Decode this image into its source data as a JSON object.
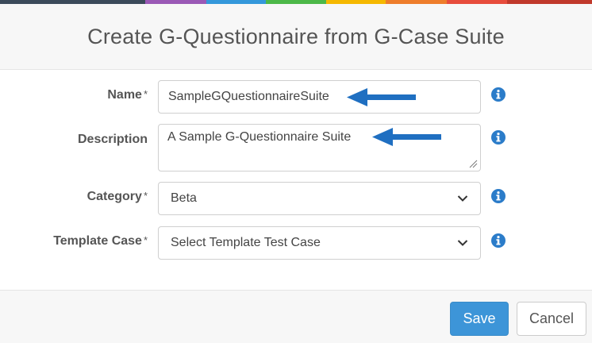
{
  "stripe_colors": [
    "#3b4a5a",
    "#9b59b6",
    "#3498db",
    "#4cb848",
    "#f5b800",
    "#ee7d2b",
    "#e74c3c",
    "#c0392b"
  ],
  "dialog": {
    "title": "Create G-Questionnaire from G-Case Suite"
  },
  "form": {
    "name": {
      "label": "Name",
      "required_mark": "*",
      "value": "SampleGQuestionnaireSuite"
    },
    "description": {
      "label": "Description",
      "value": "A Sample G-Questionnaire Suite"
    },
    "category": {
      "label": "Category",
      "required_mark": "*",
      "selected": "Beta"
    },
    "template_case": {
      "label": "Template Case",
      "required_mark": "*",
      "selected": "Select Template Test Case"
    }
  },
  "footer": {
    "save_label": "Save",
    "cancel_label": "Cancel"
  },
  "colors": {
    "annotation_arrow": "#1f6fc1",
    "info_icon": "#2b7cc9",
    "save_button": "#3d95d8"
  },
  "icons": [
    "info-icon",
    "chevron-down-icon",
    "resize-grip-icon",
    "annotation-arrow-icon"
  ]
}
